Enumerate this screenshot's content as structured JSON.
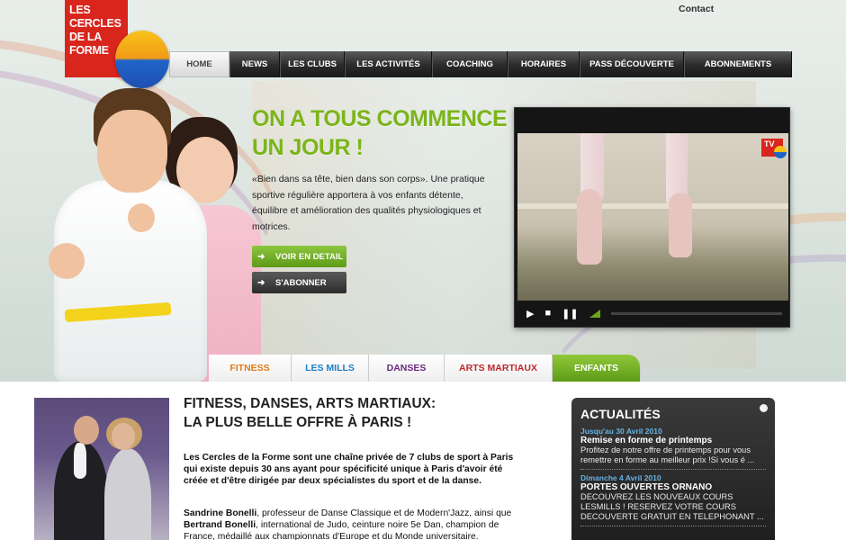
{
  "brand": {
    "logo_text": "LES\nCERCLES\nDE LA\nFORME",
    "colors": {
      "red": "#d8261d",
      "green": "#7bb51a",
      "dark": "#2a2a2a"
    }
  },
  "top": {
    "contact_label": "Contact"
  },
  "nav": {
    "items": [
      {
        "label": "HOME",
        "active": true
      },
      {
        "label": "NEWS"
      },
      {
        "label": "LES CLUBS"
      },
      {
        "label": "LES ACTIVITÉS"
      },
      {
        "label": "COACHING"
      },
      {
        "label": "HORAIRES"
      },
      {
        "label": "PASS  DÉCOUVERTE"
      },
      {
        "label": "ABONNEMENTS"
      }
    ]
  },
  "hero": {
    "headline": "ON A TOUS COMMENCE UN JOUR !",
    "intro": "«Bien dans sa tête, bien dans son corps». Une pratique sportive régulière apportera à vos enfants détente, équilibre et amélioration des qualités physiologiques et motrices.",
    "btn_detail": "VOIR EN DETAIL",
    "btn_subscribe": "S'ABONNER",
    "video": {
      "badge": "TV",
      "progress": 0.0
    }
  },
  "categories": [
    {
      "label": "FITNESS",
      "color": "#e07b1a"
    },
    {
      "label": "LES MILLS",
      "color": "#1f7fc6"
    },
    {
      "label": "DANSES",
      "color": "#6a2a7a"
    },
    {
      "label": "ARTS MARTIAUX",
      "color": "#c0282a"
    },
    {
      "label": "ENFANTS",
      "color": "#ffffff",
      "active": true
    }
  ],
  "content": {
    "title": "FITNESS, DANSES, ARTS MARTIAUX:\nLA PLUS BELLE OFFRE À PARIS !",
    "para1": "Les Cercles de la Forme sont une chaîne privée de 7 clubs de sport à Paris qui existe depuis 30 ans ayant pour spécificité unique à Paris d'avoir été créée et d'être dirigée par deux spécialistes du sport et de la danse.",
    "name1": "Sandrine Bonelli",
    "para2a": ", professeur de Danse Classique et de Modern'Jazz, ainsi que ",
    "name2": "Bertrand Bonelli",
    "para2b": ", international de Judo, ceinture noire 5e Dan, champion de France, médaillé aux championnats d'Europe et du Monde universitaire."
  },
  "news": {
    "title": "ACTUALITÉS",
    "items": [
      {
        "date": "Jusqu'au 30 Avril 2010",
        "head": "Remise en forme de printemps",
        "text": "Profitez de notre offre de printemps pour vous remettre en forme au meilleur prix !Si vous é ..."
      },
      {
        "date": "Dimanche 4 Avril 2010",
        "head": "PORTES OUVERTES ORNANO",
        "text": "DECOUVREZ LES NOUVEAUX COURS LESMILLS ! RESERVEZ VOTRE COURS DECOUVERTE GRATUIT EN TELEPHONANT ..."
      }
    ]
  }
}
